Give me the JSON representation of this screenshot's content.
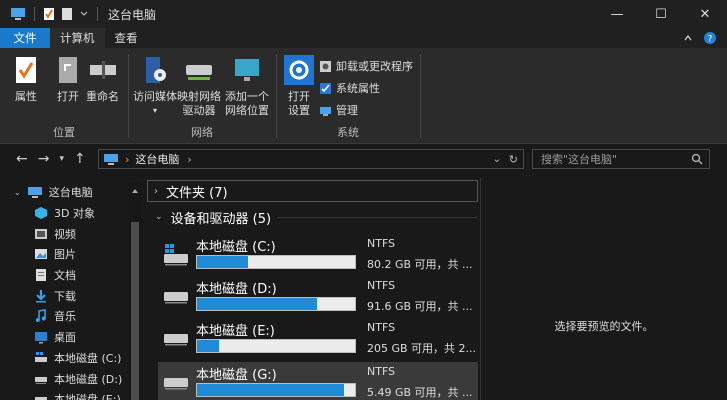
{
  "window": {
    "title": "这台电脑",
    "minimize": "—",
    "maximize": "☐",
    "close": "✕"
  },
  "ribbon_tabs": [
    {
      "label": "文件"
    },
    {
      "label": "计算机"
    },
    {
      "label": "查看"
    }
  ],
  "ribbon": {
    "location_group": {
      "label": "位置",
      "buttons": [
        {
          "label": "属性"
        },
        {
          "label": "打开"
        },
        {
          "label": "重命名"
        }
      ]
    },
    "network_group": {
      "label": "网络",
      "buttons": [
        {
          "label": "访问媒体",
          "has_dropdown": true
        },
        {
          "label": "映射网络\n驱动器",
          "has_dropdown": true
        },
        {
          "label": "添加一个\n网络位置"
        }
      ]
    },
    "system_group": {
      "label": "系统",
      "open_settings": "打开\n设置",
      "items": [
        {
          "label": "卸载或更改程序"
        },
        {
          "label": "系统属性"
        },
        {
          "label": "管理"
        }
      ]
    }
  },
  "address": {
    "path": "这台电脑",
    "search_placeholder": "搜索\"这台电脑\""
  },
  "sidebar": {
    "items": [
      {
        "label": "这台电脑"
      },
      {
        "label": "3D 对象"
      },
      {
        "label": "视频"
      },
      {
        "label": "图片"
      },
      {
        "label": "文档"
      },
      {
        "label": "下载"
      },
      {
        "label": "音乐"
      },
      {
        "label": "桌面"
      },
      {
        "label": "本地磁盘 (C:)"
      },
      {
        "label": "本地磁盘 (D:)"
      },
      {
        "label": "本地磁盘 (E:)"
      }
    ]
  },
  "main": {
    "folders_header": "文件夹 (7)",
    "devices_header": "设备和驱动器 (5)",
    "drives": [
      {
        "name": "本地磁盘 (C:)",
        "fs": "NTFS",
        "free": "80.2 GB 可用，共 ...",
        "used_fraction": 0.32
      },
      {
        "name": "本地磁盘 (D:)",
        "fs": "NTFS",
        "free": "91.6 GB 可用，共 ...",
        "used_fraction": 0.76
      },
      {
        "name": "本地磁盘 (E:)",
        "fs": "NTFS",
        "free": "205 GB 可用，共 2...",
        "used_fraction": 0.14
      },
      {
        "name": "本地磁盘 (G:)",
        "fs": "NTFS",
        "free": "5.49 GB 可用，共 ...",
        "used_fraction": 0.93
      }
    ]
  },
  "preview": {
    "message": "选择要预览的文件。"
  },
  "colors": {
    "accent": "#1979ca",
    "bar_fill": "#1f8ad6",
    "background": "#191919"
  }
}
